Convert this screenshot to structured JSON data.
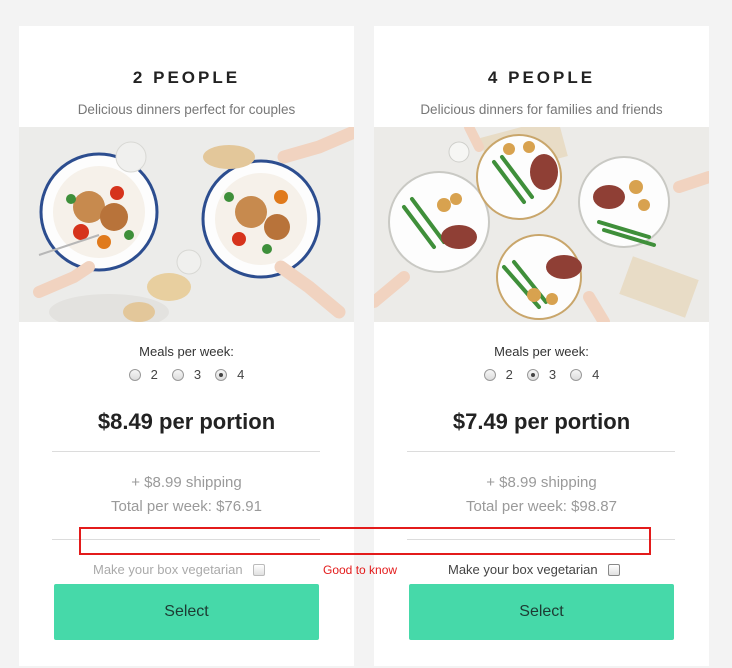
{
  "plans": [
    {
      "title": "2 PEOPLE",
      "subtitle": "Delicious dinners perfect for couples",
      "image_alt": "food-photo-two-plates",
      "meals_label": "Meals per week:",
      "meal_options": [
        "2",
        "3",
        "4"
      ],
      "selected_meals": "4",
      "price": "$8.49 per portion",
      "shipping": "+ $8.99 shipping",
      "total": "Total per week: $76.91",
      "veg_label": "Make your box vegetarian",
      "veg_enabled": false,
      "select_label": "Select"
    },
    {
      "title": "4 PEOPLE",
      "subtitle": "Delicious dinners for families and friends",
      "image_alt": "food-photo-four-plates",
      "meals_label": "Meals per week:",
      "meal_options": [
        "2",
        "3",
        "4"
      ],
      "selected_meals": "3",
      "price": "$7.49 per portion",
      "shipping": "+ $8.99 shipping",
      "total": "Total per week: $98.87",
      "veg_label": "Make your box vegetarian",
      "veg_enabled": true,
      "select_label": "Select"
    }
  ],
  "annotation": {
    "label": "Good to know",
    "color": "#e31b1b"
  },
  "colors": {
    "accent": "#46d9a9",
    "background": "#f3f3f3"
  }
}
